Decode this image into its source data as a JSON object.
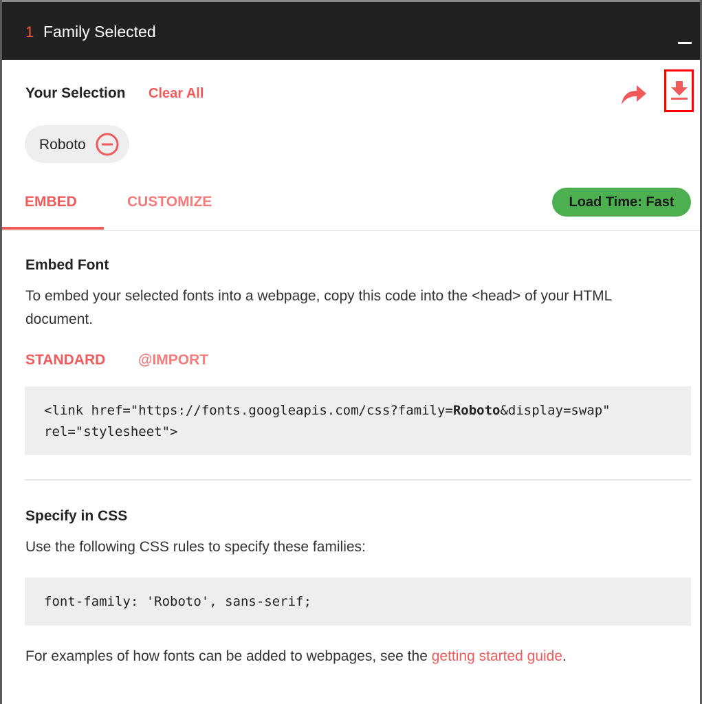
{
  "header": {
    "count": "1",
    "title": "Family Selected"
  },
  "selection": {
    "title": "Your Selection",
    "clear_all": "Clear All",
    "families": [
      "Roboto"
    ]
  },
  "tabs": {
    "embed": "EMBED",
    "customize": "CUSTOMIZE",
    "load_time": "Load Time: Fast"
  },
  "embed_font": {
    "heading": "Embed Font",
    "description": "To embed your selected fonts into a webpage, copy this code into the <head> of your HTML document.",
    "subtab_standard": "STANDARD",
    "subtab_import": "@IMPORT",
    "code_prefix": "<link href=\"https://fonts.googleapis.com/css?family=",
    "code_family": "Roboto",
    "code_suffix": "&display=swap\"",
    "code_line2": "rel=\"stylesheet\">"
  },
  "specify_css": {
    "heading": "Specify in CSS",
    "description": "Use the following CSS rules to specify these families:",
    "code": "font-family: 'Roboto', sans-serif;"
  },
  "footer": {
    "text": "For examples of how fonts can be added to webpages, see the ",
    "link": "getting started guide",
    "period": "."
  },
  "colors": {
    "accent": "#f15a5a",
    "header_bg": "#212121",
    "badge_green": "#4caf50",
    "highlight_border": "#ff0000"
  },
  "icons": [
    "share-icon",
    "download-icon",
    "remove-circle-icon",
    "minimize-icon"
  ]
}
